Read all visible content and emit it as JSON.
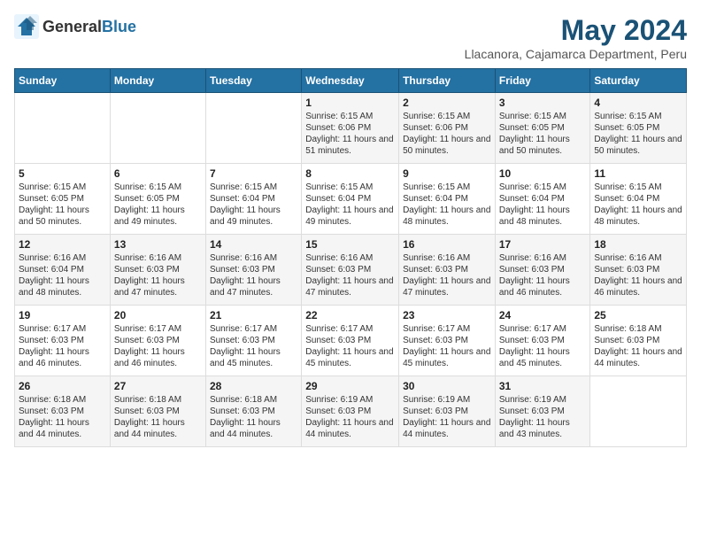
{
  "logo": {
    "general": "General",
    "blue": "Blue"
  },
  "title": "May 2024",
  "location": "Llacanora, Cajamarca Department, Peru",
  "weekdays": [
    "Sunday",
    "Monday",
    "Tuesday",
    "Wednesday",
    "Thursday",
    "Friday",
    "Saturday"
  ],
  "weeks": [
    [
      {
        "day": "",
        "sunrise": "",
        "sunset": "",
        "daylight": ""
      },
      {
        "day": "",
        "sunrise": "",
        "sunset": "",
        "daylight": ""
      },
      {
        "day": "",
        "sunrise": "",
        "sunset": "",
        "daylight": ""
      },
      {
        "day": "1",
        "sunrise": "Sunrise: 6:15 AM",
        "sunset": "Sunset: 6:06 PM",
        "daylight": "Daylight: 11 hours and 51 minutes."
      },
      {
        "day": "2",
        "sunrise": "Sunrise: 6:15 AM",
        "sunset": "Sunset: 6:06 PM",
        "daylight": "Daylight: 11 hours and 50 minutes."
      },
      {
        "day": "3",
        "sunrise": "Sunrise: 6:15 AM",
        "sunset": "Sunset: 6:05 PM",
        "daylight": "Daylight: 11 hours and 50 minutes."
      },
      {
        "day": "4",
        "sunrise": "Sunrise: 6:15 AM",
        "sunset": "Sunset: 6:05 PM",
        "daylight": "Daylight: 11 hours and 50 minutes."
      }
    ],
    [
      {
        "day": "5",
        "sunrise": "Sunrise: 6:15 AM",
        "sunset": "Sunset: 6:05 PM",
        "daylight": "Daylight: 11 hours and 50 minutes."
      },
      {
        "day": "6",
        "sunrise": "Sunrise: 6:15 AM",
        "sunset": "Sunset: 6:05 PM",
        "daylight": "Daylight: 11 hours and 49 minutes."
      },
      {
        "day": "7",
        "sunrise": "Sunrise: 6:15 AM",
        "sunset": "Sunset: 6:04 PM",
        "daylight": "Daylight: 11 hours and 49 minutes."
      },
      {
        "day": "8",
        "sunrise": "Sunrise: 6:15 AM",
        "sunset": "Sunset: 6:04 PM",
        "daylight": "Daylight: 11 hours and 49 minutes."
      },
      {
        "day": "9",
        "sunrise": "Sunrise: 6:15 AM",
        "sunset": "Sunset: 6:04 PM",
        "daylight": "Daylight: 11 hours and 48 minutes."
      },
      {
        "day": "10",
        "sunrise": "Sunrise: 6:15 AM",
        "sunset": "Sunset: 6:04 PM",
        "daylight": "Daylight: 11 hours and 48 minutes."
      },
      {
        "day": "11",
        "sunrise": "Sunrise: 6:15 AM",
        "sunset": "Sunset: 6:04 PM",
        "daylight": "Daylight: 11 hours and 48 minutes."
      }
    ],
    [
      {
        "day": "12",
        "sunrise": "Sunrise: 6:16 AM",
        "sunset": "Sunset: 6:04 PM",
        "daylight": "Daylight: 11 hours and 48 minutes."
      },
      {
        "day": "13",
        "sunrise": "Sunrise: 6:16 AM",
        "sunset": "Sunset: 6:03 PM",
        "daylight": "Daylight: 11 hours and 47 minutes."
      },
      {
        "day": "14",
        "sunrise": "Sunrise: 6:16 AM",
        "sunset": "Sunset: 6:03 PM",
        "daylight": "Daylight: 11 hours and 47 minutes."
      },
      {
        "day": "15",
        "sunrise": "Sunrise: 6:16 AM",
        "sunset": "Sunset: 6:03 PM",
        "daylight": "Daylight: 11 hours and 47 minutes."
      },
      {
        "day": "16",
        "sunrise": "Sunrise: 6:16 AM",
        "sunset": "Sunset: 6:03 PM",
        "daylight": "Daylight: 11 hours and 47 minutes."
      },
      {
        "day": "17",
        "sunrise": "Sunrise: 6:16 AM",
        "sunset": "Sunset: 6:03 PM",
        "daylight": "Daylight: 11 hours and 46 minutes."
      },
      {
        "day": "18",
        "sunrise": "Sunrise: 6:16 AM",
        "sunset": "Sunset: 6:03 PM",
        "daylight": "Daylight: 11 hours and 46 minutes."
      }
    ],
    [
      {
        "day": "19",
        "sunrise": "Sunrise: 6:17 AM",
        "sunset": "Sunset: 6:03 PM",
        "daylight": "Daylight: 11 hours and 46 minutes."
      },
      {
        "day": "20",
        "sunrise": "Sunrise: 6:17 AM",
        "sunset": "Sunset: 6:03 PM",
        "daylight": "Daylight: 11 hours and 46 minutes."
      },
      {
        "day": "21",
        "sunrise": "Sunrise: 6:17 AM",
        "sunset": "Sunset: 6:03 PM",
        "daylight": "Daylight: 11 hours and 45 minutes."
      },
      {
        "day": "22",
        "sunrise": "Sunrise: 6:17 AM",
        "sunset": "Sunset: 6:03 PM",
        "daylight": "Daylight: 11 hours and 45 minutes."
      },
      {
        "day": "23",
        "sunrise": "Sunrise: 6:17 AM",
        "sunset": "Sunset: 6:03 PM",
        "daylight": "Daylight: 11 hours and 45 minutes."
      },
      {
        "day": "24",
        "sunrise": "Sunrise: 6:17 AM",
        "sunset": "Sunset: 6:03 PM",
        "daylight": "Daylight: 11 hours and 45 minutes."
      },
      {
        "day": "25",
        "sunrise": "Sunrise: 6:18 AM",
        "sunset": "Sunset: 6:03 PM",
        "daylight": "Daylight: 11 hours and 44 minutes."
      }
    ],
    [
      {
        "day": "26",
        "sunrise": "Sunrise: 6:18 AM",
        "sunset": "Sunset: 6:03 PM",
        "daylight": "Daylight: 11 hours and 44 minutes."
      },
      {
        "day": "27",
        "sunrise": "Sunrise: 6:18 AM",
        "sunset": "Sunset: 6:03 PM",
        "daylight": "Daylight: 11 hours and 44 minutes."
      },
      {
        "day": "28",
        "sunrise": "Sunrise: 6:18 AM",
        "sunset": "Sunset: 6:03 PM",
        "daylight": "Daylight: 11 hours and 44 minutes."
      },
      {
        "day": "29",
        "sunrise": "Sunrise: 6:19 AM",
        "sunset": "Sunset: 6:03 PM",
        "daylight": "Daylight: 11 hours and 44 minutes."
      },
      {
        "day": "30",
        "sunrise": "Sunrise: 6:19 AM",
        "sunset": "Sunset: 6:03 PM",
        "daylight": "Daylight: 11 hours and 44 minutes."
      },
      {
        "day": "31",
        "sunrise": "Sunrise: 6:19 AM",
        "sunset": "Sunset: 6:03 PM",
        "daylight": "Daylight: 11 hours and 43 minutes."
      },
      {
        "day": "",
        "sunrise": "",
        "sunset": "",
        "daylight": ""
      }
    ]
  ]
}
